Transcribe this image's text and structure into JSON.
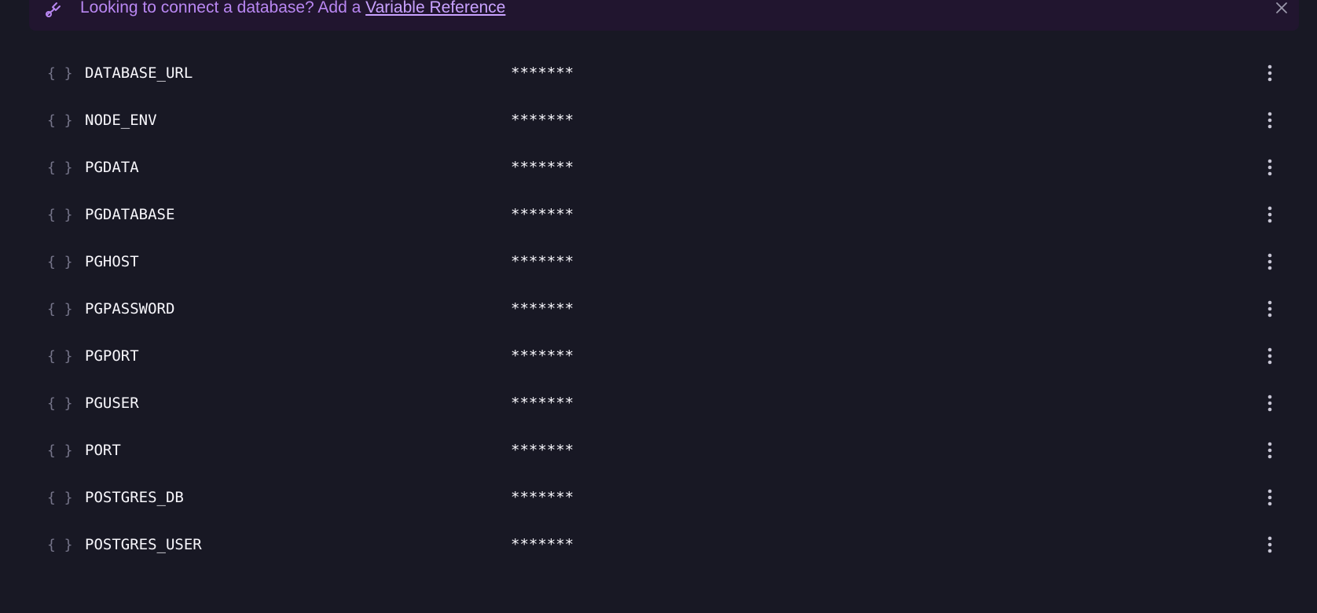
{
  "banner": {
    "text": "Looking to connect a database? Add a",
    "link_text": "Variable Reference",
    "icon": "plug-icon",
    "close_icon": "close-icon"
  },
  "variables": [
    {
      "name": "DATABASE_URL",
      "value": "*******"
    },
    {
      "name": "NODE_ENV",
      "value": "*******"
    },
    {
      "name": "PGDATA",
      "value": "*******"
    },
    {
      "name": "PGDATABASE",
      "value": "*******"
    },
    {
      "name": "PGHOST",
      "value": "*******"
    },
    {
      "name": "PGPASSWORD",
      "value": "*******"
    },
    {
      "name": "PGPORT",
      "value": "*******"
    },
    {
      "name": "PGUSER",
      "value": "*******"
    },
    {
      "name": "PORT",
      "value": "*******"
    },
    {
      "name": "POSTGRES_DB",
      "value": "*******"
    },
    {
      "name": "POSTGRES_USER",
      "value": "*******"
    }
  ],
  "row": {
    "type_icon_text": "{ }",
    "menu_icon": "more-vertical-icon"
  },
  "colors": {
    "background": "#181824",
    "banner_background": "#21152f",
    "accent": "#b987f2",
    "text": "#f8f7fc",
    "muted": "#76758a"
  }
}
